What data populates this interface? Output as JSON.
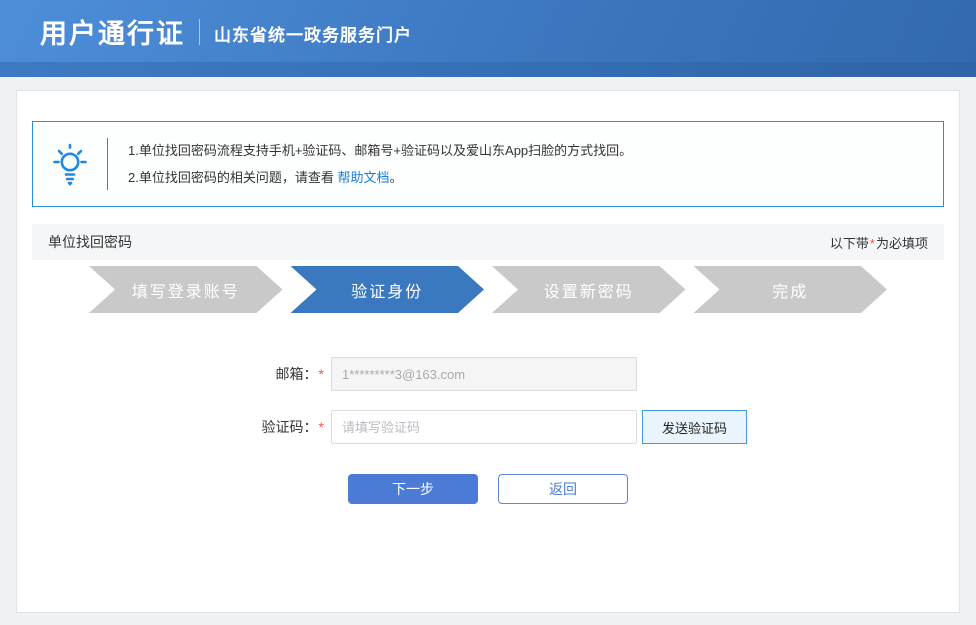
{
  "header": {
    "title": "用户通行证",
    "subtitle": "山东省统一政务服务门户"
  },
  "notice": {
    "icon": "lightbulb-icon",
    "line1": "1.单位找回密码流程支持手机+验证码、邮箱号+验证码以及爱山东App扫脸的方式找回。",
    "line2_prefix": "2.单位找回密码的相关问题，请查看 ",
    "line2_link": "帮助文档",
    "line2_suffix": "。"
  },
  "section": {
    "title": "单位找回密码",
    "required_note_prefix": "以下带",
    "required_mark": "*",
    "required_note_suffix": "为必填项"
  },
  "steps": [
    {
      "label": "填写登录账号",
      "state": "inactive"
    },
    {
      "label": "验证身份",
      "state": "active"
    },
    {
      "label": "设置新密码",
      "state": "inactive"
    },
    {
      "label": "完成",
      "state": "inactive"
    }
  ],
  "form": {
    "email": {
      "label": "邮箱：",
      "required_mark": "*",
      "value": "1*********3@163.com"
    },
    "code": {
      "label": "验证码：",
      "required_mark": "*",
      "placeholder": "请填写验证码"
    },
    "send_code_button": "发送验证码"
  },
  "actions": {
    "next_button": "下一步",
    "back_button": "返回"
  },
  "colors": {
    "header_gradient_start": "#4e8ed9",
    "header_gradient_end": "#336aaf",
    "header_strip_start": "#3e7ac3",
    "header_strip_end": "#2f64a6",
    "notice_border_blue": "#2b8fd8",
    "accent_blue": "#1e88e5",
    "link_blue": "#1a7ed8",
    "step_active_blue": "#3a78bf",
    "step_inactive_gray": "#c9c9c9",
    "primary_button_blue": "#4c7bd5",
    "send_button_bg": "#e9f4fc",
    "send_button_border": "#4399d5",
    "required_red": "#f25555"
  }
}
